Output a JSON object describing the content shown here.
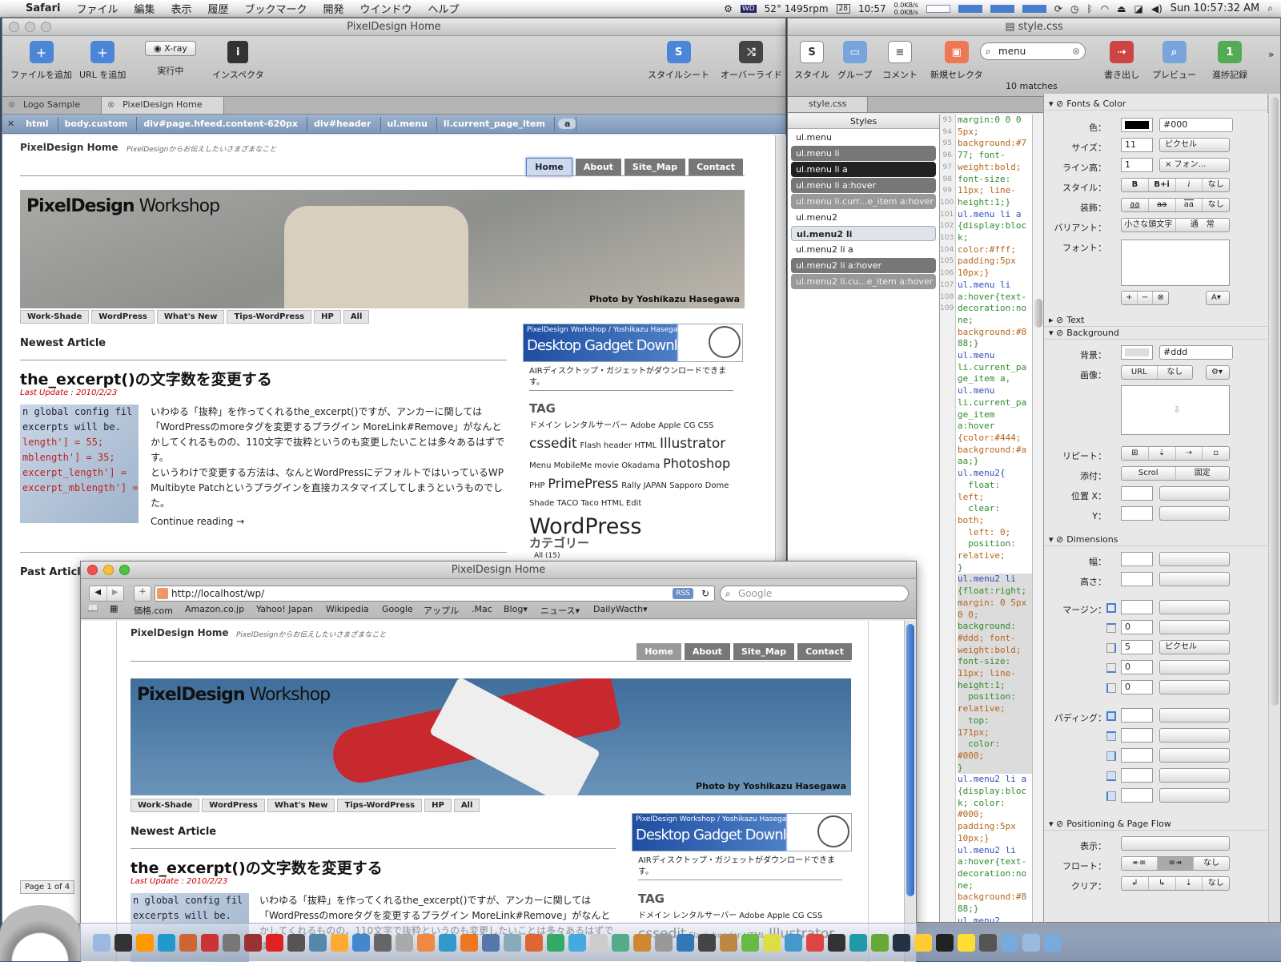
{
  "menubar": {
    "app": "Safari",
    "items": [
      "ファイル",
      "編集",
      "表示",
      "履歴",
      "ブックマーク",
      "開発",
      "ウインドウ",
      "ヘルプ"
    ],
    "temp": "52° 1495rpm",
    "cal_day": "28",
    "time_small": "10:57",
    "net_up": "0.0KB/s",
    "net_down": "0.0KB/s",
    "clock": "Sun 10:57:32 AM"
  },
  "win1": {
    "title": "PixelDesign Home",
    "toolbar": {
      "add_file": "ファイルを追加",
      "add_url": "URL を追加",
      "xray": "X-ray",
      "running": "実行中",
      "inspector": "インスペクタ",
      "stylesheet": "スタイルシート",
      "override": "オーバーライド"
    },
    "tabs": [
      "Logo Sample",
      "PixelDesign Home"
    ],
    "crumbs": [
      "html",
      "body.custom",
      "div#page.hfeed.content-620px",
      "div#header",
      "ul.menu",
      "li.current_page_item",
      "a"
    ]
  },
  "site": {
    "title": "PixelDesign Home",
    "tagline": "PixelDesignからお伝えしたいさまざまなこと",
    "nav": [
      "Home",
      "About",
      "Site_Map",
      "Contact"
    ],
    "logo_bold": "PixelDesign",
    "logo_light": " Workshop",
    "credit": "Photo by Yoshikazu Hasegawa",
    "cats": [
      "Work-Shade",
      "WordPress",
      "What's New",
      "Tips-WordPress",
      "HP",
      "All"
    ],
    "newest": "Newest Article",
    "article_title": "the_excerpt()の文字数を変更する",
    "last_update": "Last Update : 2010/2/23",
    "body1": "いわゆる「抜粋」を作ってくれるthe_excerpt()ですが、アンカーに関しては「WordPressのmoreタグを変更するプラグイン MoreLink#Remove」がなんとかしてくれるものの、110文字で抜粋というのも変更したいことは多々あるはずです。",
    "body2": "というわけで変更する方法は、なんとWordPressにデフォルトではいっているWP Multibyte Patchというプラグインを直接カスタマイズしてしまうというものでした。",
    "continue": "Continue reading →",
    "past": "Past Article",
    "banner_small": "PixelDesign Workshop / Yoshikazu Hasegawa",
    "banner_big": "Desktop Gadget Download",
    "banner_note": "AIRディスクトップ・ガジェットがダウンロードできます。",
    "tag_heading": "TAG",
    "tags_row1": "ドメイン レンタルサーバー Adobe Apple CG CSS",
    "tag_cssedit": "cssedit",
    "tags_row2": "Flash header HTML",
    "tag_illustrator": "Illustrator",
    "tags_row3": "Menu MobileMe movie Okadama",
    "tag_photoshop": "Photoshop",
    "tag_php": "PHP",
    "tag_primepress": "PrimePress",
    "tags_row4": "Rally JAPAN Sapporo Dome",
    "tags_row5": "Shade TACO Taco HTML Edit",
    "tag_wordpress": "WordPress",
    "cat_heading": "カテゴリー",
    "cat_all": "All (15)",
    "thumb_lines": [
      "n global config fil",
      "excerpts will be.",
      "length'] = 55;",
      "mblength'] = 35;",
      "excerpt_length'] =",
      "excerpt_mblength'] ="
    ]
  },
  "css": {
    "title": "style.css",
    "toolbar": {
      "style": "スタイル",
      "group": "グループ",
      "comment": "コメント",
      "new_selector": "新規セレクタ",
      "search": "menu",
      "matches": "10 matches",
      "export": "書き出し",
      "preview": "プレビュー",
      "milestone": "進捗記録"
    },
    "tab": "style.css",
    "styles_header": "Styles",
    "styles": [
      "ul.menu",
      "ul.menu li",
      "ul.menu li a",
      "ul.menu li a:hover",
      "ul.menu li.curr...e_item a:hover",
      "ul.menu2",
      "ul.menu2 li",
      "ul.menu2 li a",
      "ul.menu2 li a:hover",
      "ul.menu2 li.cu...e_item a:hover"
    ],
    "gutter": [
      "",
      "",
      "",
      "",
      "",
      "",
      "",
      "",
      "93",
      "",
      "",
      "",
      "",
      "",
      "",
      "94",
      "",
      "",
      "",
      "",
      "",
      "95",
      "",
      "",
      "",
      "",
      "",
      "",
      "",
      "",
      "96",
      "97",
      "98",
      "",
      "99",
      "",
      "100",
      "101",
      "",
      "102",
      "103",
      "",
      "",
      "",
      "",
      "",
      "",
      "",
      "104",
      "105",
      "106",
      "",
      "107",
      "108",
      "",
      "",
      "",
      "",
      "",
      "109",
      "",
      "",
      ""
    ],
    "code": [
      "margin:0 0 0",
      "5px;",
      "background:#7",
      "77; font-",
      "weight:bold;",
      "font-size:",
      "11px; line-",
      "height:1;}",
      "ul.menu li a",
      "{display:bloc",
      "k;",
      "color:#fff;",
      "padding:5px",
      "10px;}",
      "ul.menu li",
      "a:hover{text-",
      "decoration:no",
      "ne;",
      "background:#8",
      "88;}",
      "ul.menu",
      "li.current_pa",
      "ge_item a,",
      "ul.menu",
      "li.current_pa",
      "ge_item",
      "a:hover",
      "{color:#444;",
      "background:#a",
      "aa;}",
      "",
      "ul.menu2{",
      "  float:",
      "left;",
      "  clear:",
      "both;",
      "  left: 0;",
      "  position:",
      "relative;",
      "}",
      "ul.menu2 li",
      "{float:right;",
      "margin: 0 5px",
      "0 0;",
      "background:",
      "#ddd; font-",
      "weight:bold;",
      "font-size:",
      "11px; line-",
      "height:1;",
      "  position:",
      "relative;",
      "  top:",
      "171px;",
      "  color:",
      "#000;",
      "}",
      "ul.menu2 li a",
      "{display:bloc",
      "k; color:",
      "#000;",
      "padding:5px",
      "10px;}",
      "ul.menu2 li",
      "a:hover{text-",
      "decoration:no",
      "ne;",
      "background:#8",
      "88;}",
      "ul.menu2"
    ],
    "inspector": {
      "fonts_color": "Fonts & Color",
      "color_label": "色：",
      "color_val": "#000",
      "size_label": "サイズ：",
      "size_val": "11",
      "size_unit": "ピクセル",
      "lh_label": "ライン高：",
      "lh_val": "1",
      "lh_unit": "× フォン…",
      "style_label": "スタイル：",
      "style_b": "B",
      "style_bi": "B+i",
      "style_i": "i",
      "style_none": "なし",
      "deco_label": "装飾：",
      "deco_none": "なし",
      "deco_a": "aa",
      "variant_label": "バリアント：",
      "variant_val": "小さな頭文字",
      "variant_normal": "通　常",
      "font_label": "フォント：",
      "text_section": "Text",
      "bg_section": "Background",
      "bg_label": "背景：",
      "bg_val": "#ddd",
      "img_label": "画像：",
      "img_url": "URL",
      "img_none": "なし",
      "repeat_label": "リピート：",
      "attach_label": "添付：",
      "attach_scroll": "Scrol",
      "attach_fixed": "固定",
      "posx_label": "位置 X：",
      "posy_label": "Y：",
      "dim_section": "Dimensions",
      "width_label": "幅：",
      "height_label": "高さ：",
      "margin_label": "マージン：",
      "margin_vals": [
        "",
        "0",
        "5",
        "0",
        "0"
      ],
      "margin_unit": "ピクセル",
      "padding_label": "パディング：",
      "pos_section": "Positioning & Page Flow",
      "display_label": "表示：",
      "float_label": "フロート：",
      "float_none": "なし",
      "clear_label": "クリア：",
      "clear_none": "なし"
    }
  },
  "win2": {
    "title": "PixelDesign Home",
    "url": "http://localhost/wp/",
    "rss": "RSS",
    "search_placeholder": "Google",
    "bookmarks": [
      "価格.com",
      "Amazon.co.jp",
      "Yahoo! Japan",
      "Wikipedia",
      "Google",
      "アップル",
      ".Mac",
      "Blog▾",
      "ニュース▾",
      "DailyWacth▾"
    ]
  },
  "misc": {
    "page_of": "Page 1 of 4"
  }
}
